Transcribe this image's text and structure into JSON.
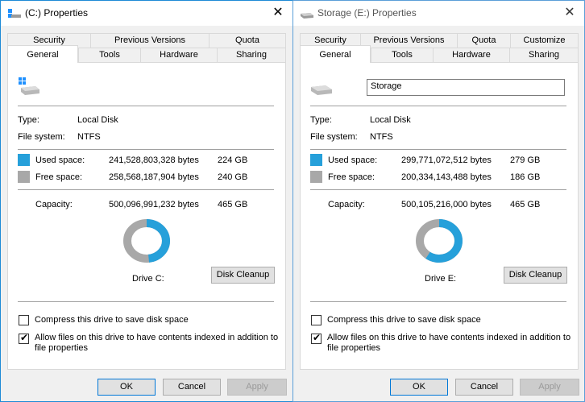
{
  "colors": {
    "used": "#26a0da",
    "free": "#a8a8a8",
    "accent": "#0078d7"
  },
  "windows": [
    {
      "title": "(C:) Properties",
      "close_icon": "close-icon",
      "tabs_back": [
        "Security",
        "Previous Versions",
        "Quota"
      ],
      "tabs_front": [
        "General",
        "Tools",
        "Hardware",
        "Sharing"
      ],
      "volume_label": "",
      "type_label": "Type:",
      "type_value": "Local Disk",
      "fs_label": "File system:",
      "fs_value": "NTFS",
      "used_label": "Used space:",
      "used_bytes": "241,528,803,328 bytes",
      "used_gb": "224 GB",
      "free_label": "Free space:",
      "free_bytes": "258,568,187,904 bytes",
      "free_gb": "240 GB",
      "capacity_label": "Capacity:",
      "capacity_bytes": "500,096,991,232 bytes",
      "capacity_gb": "465 GB",
      "used_fraction": 0.483,
      "drive_label": "Drive C:",
      "cleanup_label": "Disk Cleanup",
      "compress_label": "Compress this drive to save disk space",
      "index_label_1": "Allow files on this drive to have contents indexed in addition to",
      "index_label_2": "file properties",
      "compress_checked": false,
      "index_checked": true,
      "ok_label": "OK",
      "cancel_label": "Cancel",
      "apply_label": "Apply"
    },
    {
      "title": "Storage (E:) Properties",
      "close_icon": "close-icon",
      "tabs_back": [
        "Security",
        "Previous Versions",
        "Quota",
        "Customize"
      ],
      "tabs_front": [
        "General",
        "Tools",
        "Hardware",
        "Sharing"
      ],
      "volume_label": "Storage",
      "type_label": "Type:",
      "type_value": "Local Disk",
      "fs_label": "File system:",
      "fs_value": "NTFS",
      "used_label": "Used space:",
      "used_bytes": "299,771,072,512 bytes",
      "used_gb": "279 GB",
      "free_label": "Free space:",
      "free_bytes": "200,334,143,488 bytes",
      "free_gb": "186 GB",
      "capacity_label": "Capacity:",
      "capacity_bytes": "500,105,216,000 bytes",
      "capacity_gb": "465 GB",
      "used_fraction": 0.599,
      "drive_label": "Drive E:",
      "cleanup_label": "Disk Cleanup",
      "compress_label": "Compress this drive to save disk space",
      "index_label_1": "Allow files on this drive to have contents indexed in addition to",
      "index_label_2": "file properties",
      "compress_checked": false,
      "index_checked": true,
      "ok_label": "OK",
      "cancel_label": "Cancel",
      "apply_label": "Apply"
    }
  ]
}
